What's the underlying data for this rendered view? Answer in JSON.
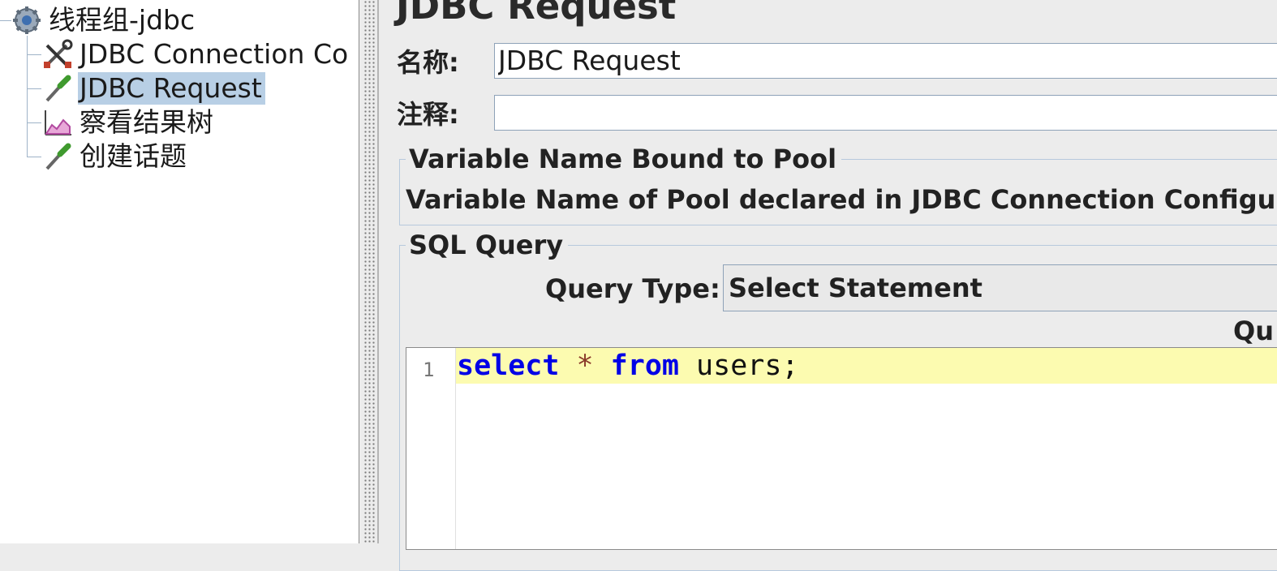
{
  "tree": {
    "root": {
      "label": "线程组-jdbc",
      "icon": "gear-icon"
    },
    "children": [
      {
        "label": "JDBC Connection Co",
        "icon": "tools-icon"
      },
      {
        "label": "JDBC Request",
        "icon": "pipette-icon",
        "selected": true
      },
      {
        "label": "察看结果树",
        "icon": "graph-icon"
      },
      {
        "label": "创建话题",
        "icon": "pipette-icon"
      }
    ]
  },
  "form": {
    "title": "JDBC Request",
    "name_label": "名称:",
    "name_value": "JDBC Request",
    "comment_label": "注释:",
    "comment_value": "",
    "pool_group": {
      "title": "Variable Name Bound to Pool",
      "description": "Variable Name of Pool declared in JDBC Connection Configu"
    },
    "sql_group": {
      "title": "SQL Query",
      "query_type_label": "Query Type:",
      "query_type_value": "Select Statement",
      "query_label_partial": "Qu",
      "editor": {
        "line_number": "1",
        "tokens": [
          "select",
          "*",
          "from",
          "users;"
        ]
      }
    }
  },
  "colors": {
    "selection": "#b8cfe5",
    "keyword": "#0000e6",
    "current_line": "#fcfbb0"
  }
}
